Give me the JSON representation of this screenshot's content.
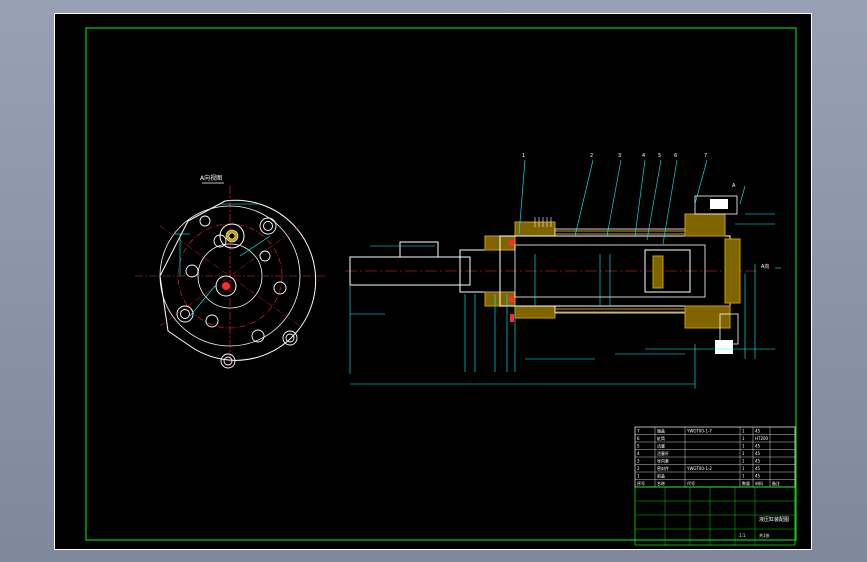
{
  "drawing": {
    "view_label": "A向视图",
    "frame_color": "#00ff00",
    "dim_color": "#00ffff",
    "center_color": "#ff2a2a",
    "part_color": "#ffffff",
    "hatch_color": "#c8a000"
  },
  "balloons": [
    "1",
    "2",
    "3",
    "4",
    "5",
    "6",
    "7"
  ],
  "aux_labels": {
    "a_mark": "A",
    "a_arrow_label": "A向"
  },
  "title_block": {
    "parts": [
      {
        "no": "7",
        "name": "端盖",
        "code": "YWGT00-1-7",
        "qty": "1",
        "mat": "45"
      },
      {
        "no": "6",
        "name": "缸筒",
        "code": "",
        "qty": "1",
        "mat": "HT200"
      },
      {
        "no": "5",
        "name": "活塞",
        "code": "",
        "qty": "1",
        "mat": "45"
      },
      {
        "no": "4",
        "name": "活塞杆",
        "code": "",
        "qty": "1",
        "mat": "45"
      },
      {
        "no": "3",
        "name": "导向套",
        "code": "",
        "qty": "1",
        "mat": "45"
      },
      {
        "no": "2",
        "name": "密封件",
        "code": "YWGT00-1-2",
        "qty": "1",
        "mat": "45"
      },
      {
        "no": "1",
        "name": "前盖",
        "code": "",
        "qty": "1",
        "mat": "45"
      }
    ],
    "header": {
      "no": "序号",
      "name": "名称",
      "code": "代号",
      "qty": "数量",
      "mat": "材料",
      "note": "备注"
    },
    "drawing_title": "液压缸装配图",
    "scale": "1:1",
    "sheet": "共1张"
  }
}
